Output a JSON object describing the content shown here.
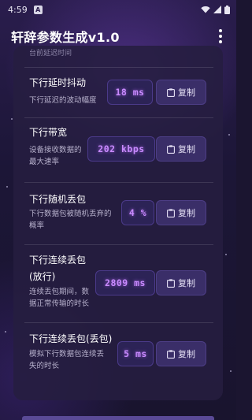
{
  "status_bar": {
    "time": "4:59",
    "app_icon_letter": "A"
  },
  "app_bar": {
    "title": "轩辞参数生成v1.0",
    "menu_icon": "overflow-menu-icon"
  },
  "card": {
    "clipped_text": "台前延迟时间",
    "params": [
      {
        "name": "下行延时抖动",
        "desc": [
          "下行延迟的波动幅度"
        ],
        "value": "18 ms",
        "copy_label": "复制"
      },
      {
        "name": "下行带宽",
        "desc": [
          "设备接收数据的",
          "最大速率"
        ],
        "value": "202 kbps",
        "copy_label": "复制"
      },
      {
        "name": "下行随机丢包",
        "desc": [
          "下行数据包被随机丢弃的",
          "概率"
        ],
        "value": "4 %",
        "copy_label": "复制"
      },
      {
        "name": [
          "下行连续丢包",
          "(放行)"
        ],
        "desc": [
          "连续丢包期间，数",
          "据正常传输的时长"
        ],
        "value": "2809 ms",
        "copy_label": "复制"
      },
      {
        "name": "下行连续丢包(丢包)",
        "desc": [
          "模拟下行数据包连续丢",
          "失的时长"
        ],
        "value": "5 ms",
        "copy_label": "复制"
      }
    ]
  },
  "colors": {
    "accent": "#c98bff",
    "card": "#261e40",
    "button": "#3a2e68"
  }
}
